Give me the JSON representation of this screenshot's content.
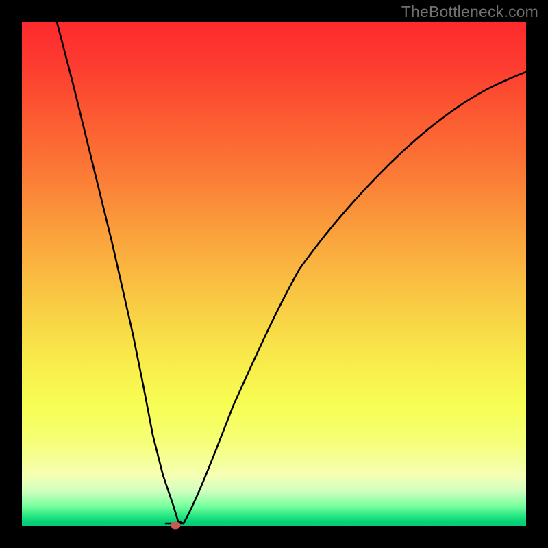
{
  "watermark": "TheBottleneck.com",
  "chart_data": {
    "type": "line",
    "title": "",
    "xlabel": "",
    "ylabel": "",
    "xlim": [
      0,
      100
    ],
    "ylim": [
      0,
      100
    ],
    "grid": false,
    "legend": false,
    "background": "vertical-rainbow-gradient",
    "series": [
      {
        "name": "bottleneck-curve",
        "x": [
          7,
          10,
          14,
          18,
          22,
          24,
          26,
          28,
          30,
          31,
          32,
          35,
          38,
          42,
          46,
          50,
          55,
          60,
          66,
          72,
          80,
          88,
          96,
          100
        ],
        "y": [
          100,
          88,
          72,
          56,
          38,
          28,
          18,
          10,
          4,
          1,
          0.5,
          6,
          14,
          24,
          33,
          42,
          51,
          58,
          65,
          71,
          77,
          82,
          86,
          88
        ]
      }
    ],
    "markers": [
      {
        "name": "min-point-dot",
        "x": 31,
        "y": 0,
        "color": "#c35b52"
      }
    ],
    "colors": {
      "gradient_top": "#fd2a2e",
      "gradient_mid": "#f8e84a",
      "gradient_bottom": "#07ca75",
      "curve": "#000000",
      "frame": "#000000"
    }
  }
}
